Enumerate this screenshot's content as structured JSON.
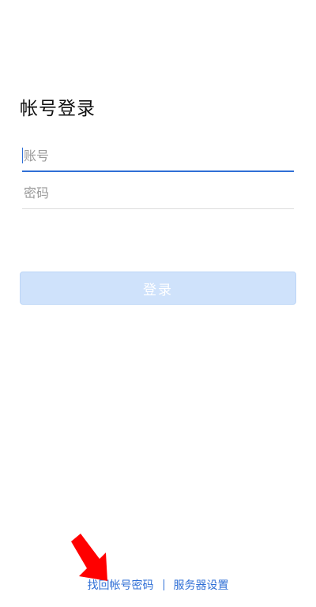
{
  "login": {
    "title": "帐号登录",
    "account_placeholder": "账号",
    "password_placeholder": "密码",
    "submit_label": "登录"
  },
  "footer": {
    "recover_link": "找回帐号密码",
    "server_settings_link": "服务器设置"
  },
  "colors": {
    "accent": "#2f6fd6",
    "button_disabled": "#cfe2fb",
    "annotation_arrow": "#ff0000"
  },
  "icons": {
    "annotation": "red-arrow-icon"
  }
}
